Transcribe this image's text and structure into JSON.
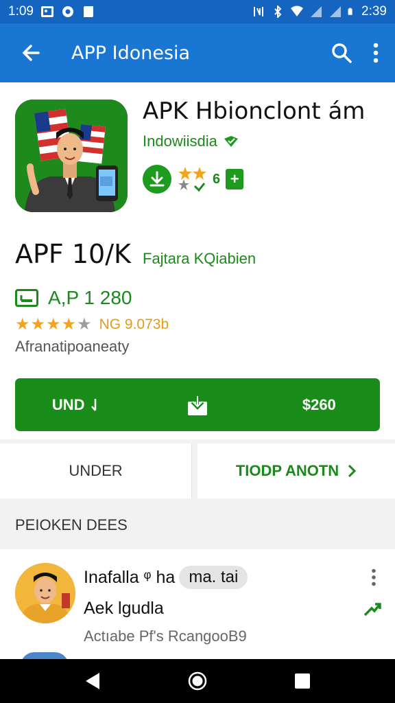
{
  "status_bar": {
    "time": "1:09",
    "clock": "2:39"
  },
  "app_bar": {
    "title": "APP Idonesia"
  },
  "app": {
    "name": "APK Hbionclont ám",
    "developer": "Indowiisdia",
    "badge_text": "6",
    "headline": "APF 10/K",
    "headline_sub": "Fajtara KQiabien",
    "size": "A,P 1 280",
    "rating": 4,
    "rating_count": "NG 9.073b",
    "category": "Afranatipoaneaty"
  },
  "install_button": {
    "left": "UND",
    "right": "$260"
  },
  "tabs": {
    "left": "UNDER",
    "right": "TIODP ANOTN"
  },
  "section": {
    "title": "PEIOKEN DEES"
  },
  "list_item": {
    "title": "Inafalla ᵠ ha",
    "chip": "ma. tai",
    "subtitle": "Aek lgudla",
    "meta": "Actıabe Pf's RcangooB9"
  },
  "colors": {
    "app_bar": "#1976d2",
    "status_bar": "#1565c0",
    "accent_green": "#1a8c1a",
    "star": "#f4a31c"
  },
  "icons": [
    "back-arrow-icon",
    "search-icon",
    "more-vert-icon",
    "download-icon",
    "chevron-right-icon",
    "trending-icon",
    "nav-back-icon",
    "nav-home-icon",
    "nav-recents-icon"
  ]
}
